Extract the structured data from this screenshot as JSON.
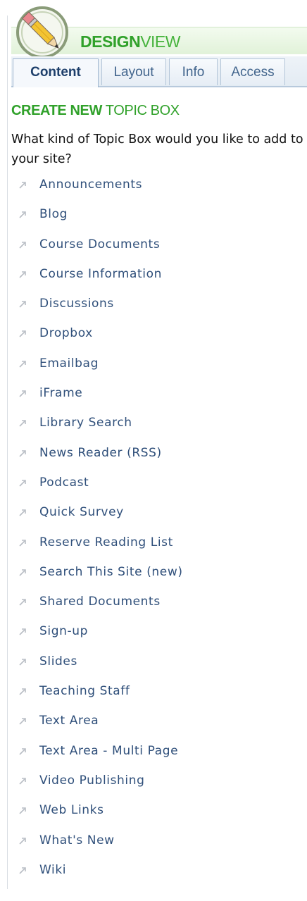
{
  "header": {
    "title_bold": "DESIGN",
    "title_thin": "VIEW",
    "logo_icon": "pencil-globe-icon"
  },
  "tabs": [
    {
      "label": "Content",
      "active": true
    },
    {
      "label": "Layout",
      "active": false
    },
    {
      "label": "Info",
      "active": false
    },
    {
      "label": "Access",
      "active": false
    }
  ],
  "section": {
    "heading_bold": "CREATE NEW",
    "heading_thin": "TOPIC BOX",
    "question": "What kind of Topic Box would you like to add to your site?"
  },
  "topic_types": [
    "Announcements",
    "Blog",
    "Course Documents",
    "Course Information",
    "Discussions",
    "Dropbox",
    "Emailbag",
    "iFrame",
    "Library Search",
    "News Reader (RSS)",
    "Podcast",
    "Quick Survey",
    "Reserve Reading List",
    "Search This Site (new)",
    "Shared Documents",
    "Sign-up",
    "Slides",
    "Teaching Staff",
    "Text Area",
    "Text Area - Multi Page",
    "Video Publishing",
    "Web Links",
    "What's New",
    "Wiki"
  ],
  "bullet_icon": "arrow-bullet-icon",
  "colors": {
    "accent_green": "#30a12a",
    "link_blue": "#2f4f7a",
    "tab_text": "#42658d"
  }
}
